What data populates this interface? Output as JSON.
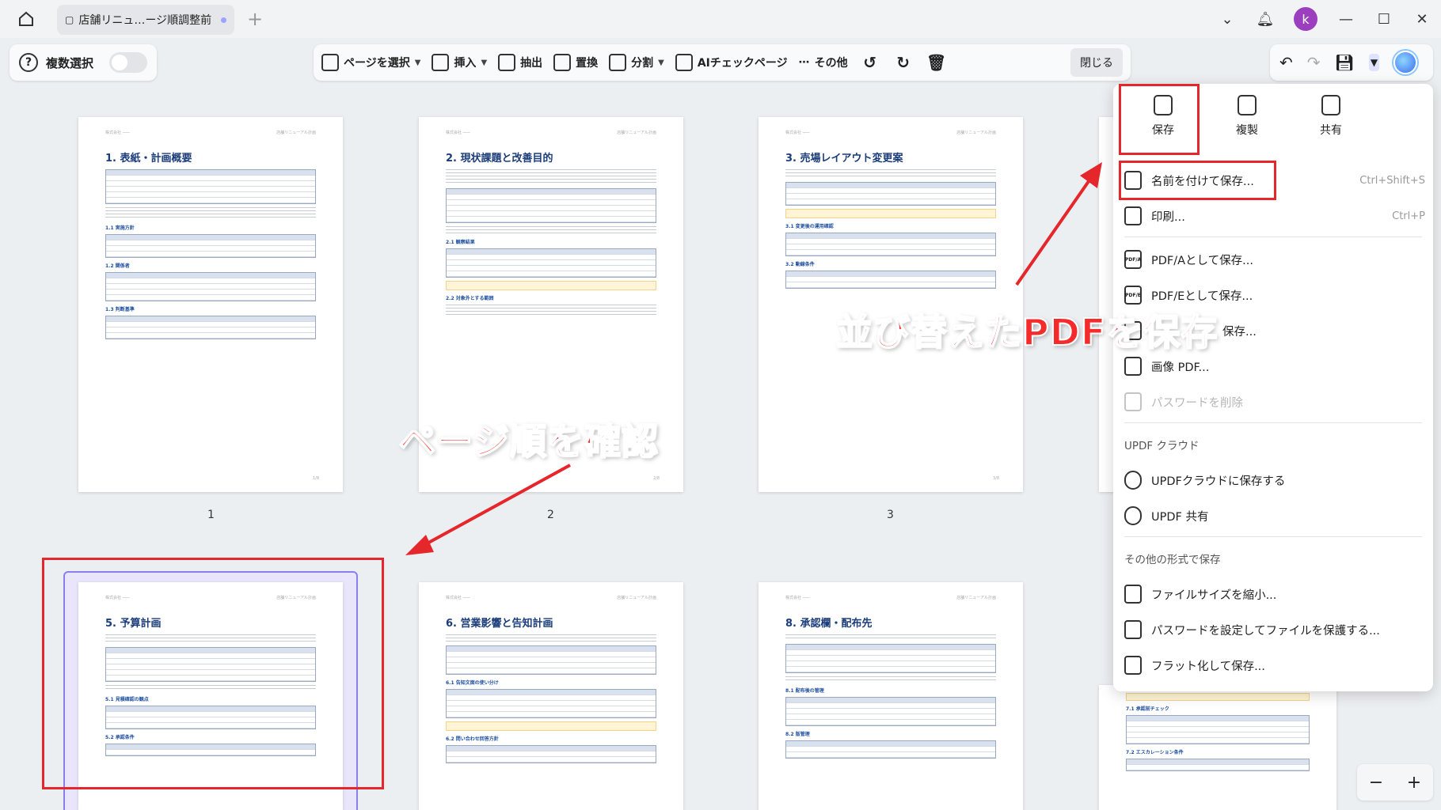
{
  "tab": {
    "title": "店舗リニュ…ージ順調整前"
  },
  "avatar_letter": "k",
  "toolbar_left": {
    "multi_select_label": "複数選択"
  },
  "toolbar": {
    "select_page": "ページを選択",
    "insert": "挿入",
    "extract": "抽出",
    "replace": "置換",
    "split": "分割",
    "ai_check": "AIチェックページ",
    "more": "その他",
    "close": "閉じる"
  },
  "pages": [
    {
      "title": "1. 表紙・計画概要",
      "number": "1"
    },
    {
      "title": "2. 現状課題と改善目的",
      "number": "2"
    },
    {
      "title": "3. 売場レイアウト変更案",
      "number": "3"
    },
    {
      "title": "5. 予算計画",
      "number": ""
    },
    {
      "title": "6. 営業影響と告知計画",
      "number": ""
    },
    {
      "title": "8. 承認欄・配布先",
      "number": ""
    }
  ],
  "page_sections": {
    "p1": [
      "1.1 実施方針",
      "1.2 関係者",
      "1.3 判断基準"
    ],
    "p2": [
      "2.1 観察結果",
      "2.2 対象外とする範囲"
    ],
    "p3": [
      "3.1 変更後の運用確認",
      "3.2 動線条件"
    ],
    "p5": [
      "5.1 見積確認の観点",
      "5.2 承認条件"
    ],
    "p6": [
      "6.1 告知文面の使い分け",
      "6.2 問い合わせ回答方針"
    ],
    "p8": [
      "8.1 配布後の管理",
      "8.2 版管理"
    ],
    "p4": [
      "7.1 承認前チェック",
      "7.2 エスカレーション条件"
    ]
  },
  "menu": {
    "top": {
      "save": "保存",
      "duplicate": "複製",
      "share": "共有"
    },
    "save_as": {
      "label": "名前を付けて保存...",
      "shortcut": "Ctrl+Shift+S"
    },
    "print": {
      "label": "印刷...",
      "shortcut": "Ctrl+P"
    },
    "pdfa": "PDF/Aとして保存...",
    "pdfe": "PDF/Eとして保存...",
    "other_save": "保存...",
    "image_pdf": "画像 PDF...",
    "remove_password": "パスワードを削除",
    "cloud_header": "UPDF クラウド",
    "save_cloud": "UPDFクラウドに保存する",
    "updf_share": "UPDF 共有",
    "other_formats_header": "その他の形式で保存",
    "reduce_size": "ファイルサイズを縮小...",
    "protect": "パスワードを設定してファイルを保護する...",
    "flatten": "フラット化して保存..."
  },
  "annotations": {
    "save_reordered": "並び替えたPDFを保存",
    "check_order": "ページ順を確認"
  },
  "colors": {
    "accent_red": "#e5262a",
    "selection": "#8b7ff0",
    "avatar": "#9b3fbf"
  },
  "icons": [
    "home-icon",
    "file-icon",
    "plus-icon",
    "chevron-down-icon",
    "bell-icon",
    "minimize-icon",
    "maximize-icon",
    "close-icon",
    "help-icon",
    "undo-icon",
    "redo-icon",
    "trash-icon",
    "save-icon",
    "duplicate-icon",
    "share-icon",
    "print-icon",
    "cloud-icon",
    "link-icon"
  ]
}
